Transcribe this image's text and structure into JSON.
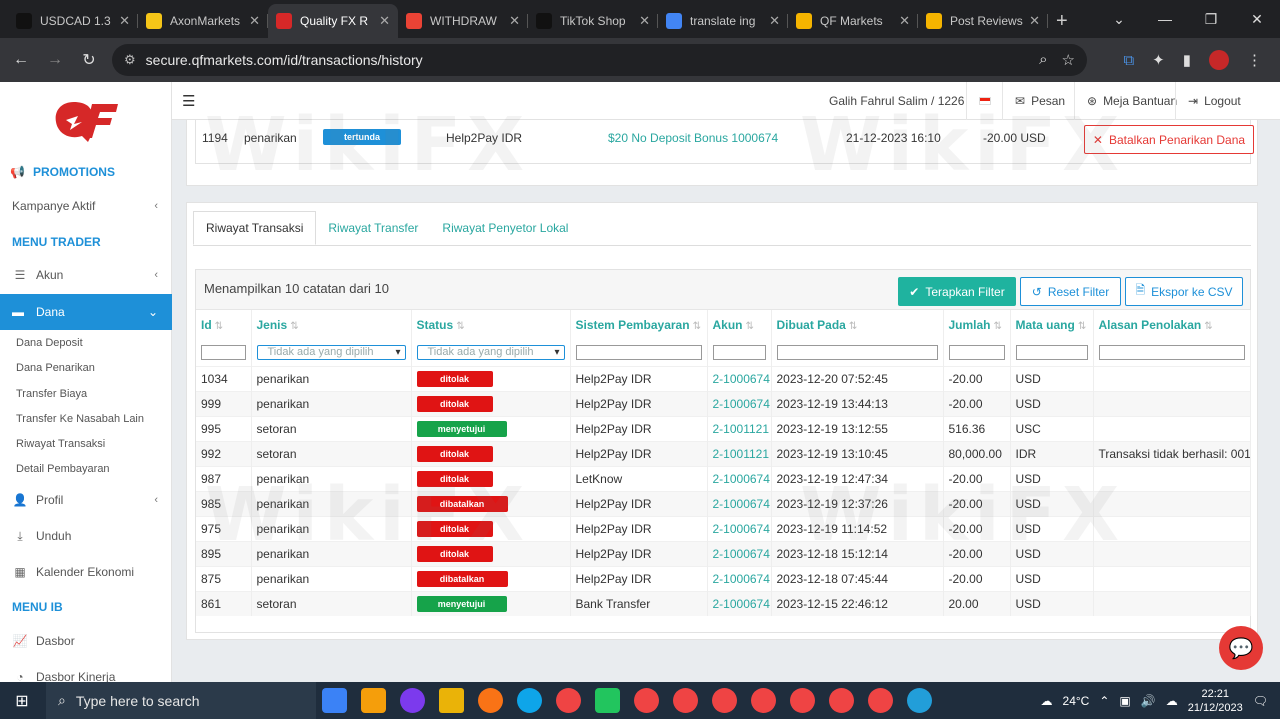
{
  "browser": {
    "tabs": [
      {
        "label": "USDCAD 1.3",
        "icon": "tradingview-icon",
        "color": "#111111"
      },
      {
        "label": "AxonMarkets",
        "icon": "axon-icon",
        "color": "#f5c518"
      },
      {
        "label": "Quality FX R",
        "icon": "qf-icon",
        "color": "#d62828",
        "active": true
      },
      {
        "label": "WITHDRAW",
        "icon": "gmail-icon",
        "color": "#ea4335"
      },
      {
        "label": "TikTok Shop",
        "icon": "tiktok-icon",
        "color": "#111111"
      },
      {
        "label": "translate ing",
        "icon": "google-icon",
        "color": "#4285f4"
      },
      {
        "label": "QF Markets",
        "icon": "qfm-icon",
        "color": "#f5b400"
      },
      {
        "label": "Post Reviews",
        "icon": "review-icon",
        "color": "#f5b400"
      }
    ],
    "url": "secure.qfmarkets.com/id/transactions/history"
  },
  "sidebar": {
    "promotions": "PROMOTIONS",
    "kampanye": "Kampanye Aktif",
    "menu_trader": "MENU TRADER",
    "akun": "Akun",
    "dana": "Dana",
    "sub_items": [
      "Dana Deposit",
      "Dana Penarikan",
      "Transfer Biaya",
      "Transfer Ke Nasabah Lain",
      "Riwayat Transaksi",
      "Detail Pembayaran"
    ],
    "profil": "Profil",
    "unduh": "Unduh",
    "kalender": "Kalender Ekonomi",
    "menu_ib": "MENU IB",
    "dasbor": "Dasbor",
    "dasbor_kinerja": "Dasbor Kinerja"
  },
  "topnav": {
    "user": "Galih Fahrul Salim / 1226",
    "pesan": "Pesan",
    "bantuan": "Meja Bantuan",
    "logout": "Logout"
  },
  "pending": {
    "id": "1194",
    "type": "penarikan",
    "status": "tertunda",
    "system": "Help2Pay IDR",
    "note": "$20 No Deposit Bonus 1000674",
    "date": "21-12-2023 16:10",
    "amount": "-20.00 USD",
    "cancel_label": "Batalkan Penarikan Dana"
  },
  "tabs": [
    "Riwayat Transaksi",
    "Riwayat Transfer",
    "Riwayat Penyetor Lokal"
  ],
  "listing": {
    "showing": "Menampilkan 10 catatan dari 10",
    "apply_filter": "Terapkan Filter",
    "reset_filter": "Reset Filter",
    "export_csv": "Ekspor ke CSV",
    "select_placeholder": "Tidak ada yang dipilih"
  },
  "table": {
    "columns": [
      "Id",
      "Jenis",
      "Status",
      "Sistem Pembayaran",
      "Akun",
      "Dibuat Pada",
      "Jumlah",
      "Mata uang",
      "Alasan Penolakan"
    ],
    "rows": [
      {
        "id": "1034",
        "type": "penarikan",
        "status": "ditolak",
        "status_kind": "reject",
        "system": "Help2Pay IDR",
        "account": "2-1000674",
        "created": "2023-12-20 07:52:45",
        "amount": "-20.00",
        "currency": "USD",
        "reason": ""
      },
      {
        "id": "999",
        "type": "penarikan",
        "status": "ditolak",
        "status_kind": "reject",
        "system": "Help2Pay IDR",
        "account": "2-1000674",
        "created": "2023-12-19 13:44:13",
        "amount": "-20.00",
        "currency": "USD",
        "reason": ""
      },
      {
        "id": "995",
        "type": "setoran",
        "status": "menyetujui",
        "status_kind": "approve",
        "system": "Help2Pay IDR",
        "account": "2-1001121",
        "created": "2023-12-19 13:12:55",
        "amount": "516.36",
        "currency": "USC",
        "reason": ""
      },
      {
        "id": "992",
        "type": "setoran",
        "status": "ditolak",
        "status_kind": "reject",
        "system": "Help2Pay IDR",
        "account": "2-1001121",
        "created": "2023-12-19 13:10:45",
        "amount": "80,000.00",
        "currency": "IDR",
        "reason": "Transaksi tidak berhasil: 001"
      },
      {
        "id": "987",
        "type": "penarikan",
        "status": "ditolak",
        "status_kind": "reject",
        "system": "LetKnow",
        "account": "2-1000674",
        "created": "2023-12-19 12:47:34",
        "amount": "-20.00",
        "currency": "USD",
        "reason": ""
      },
      {
        "id": "985",
        "type": "penarikan",
        "status": "dibatalkan",
        "status_kind": "cancel",
        "system": "Help2Pay IDR",
        "account": "2-1000674",
        "created": "2023-12-19 12:37:26",
        "amount": "-20.00",
        "currency": "USD",
        "reason": ""
      },
      {
        "id": "975",
        "type": "penarikan",
        "status": "ditolak",
        "status_kind": "reject",
        "system": "Help2Pay IDR",
        "account": "2-1000674",
        "created": "2023-12-19 11:14:52",
        "amount": "-20.00",
        "currency": "USD",
        "reason": ""
      },
      {
        "id": "895",
        "type": "penarikan",
        "status": "ditolak",
        "status_kind": "reject",
        "system": "Help2Pay IDR",
        "account": "2-1000674",
        "created": "2023-12-18 15:12:14",
        "amount": "-20.00",
        "currency": "USD",
        "reason": ""
      },
      {
        "id": "875",
        "type": "penarikan",
        "status": "dibatalkan",
        "status_kind": "cancel",
        "system": "Help2Pay IDR",
        "account": "2-1000674",
        "created": "2023-12-18 07:45:44",
        "amount": "-20.00",
        "currency": "USD",
        "reason": ""
      },
      {
        "id": "861",
        "type": "setoran",
        "status": "menyetujui",
        "status_kind": "approve",
        "system": "Bank Transfer",
        "account": "2-1000674",
        "created": "2023-12-15 22:46:12",
        "amount": "20.00",
        "currency": "USD",
        "reason": ""
      }
    ]
  },
  "watermark": "WikiFX",
  "taskbar": {
    "search": "Type here to search",
    "temp": "24°C",
    "time": "22:21",
    "date": "21/12/2023"
  },
  "colors": {
    "primary": "#1e90d8",
    "teal": "#2aa7a0",
    "danger": "#e01414",
    "success": "#16a34a"
  }
}
